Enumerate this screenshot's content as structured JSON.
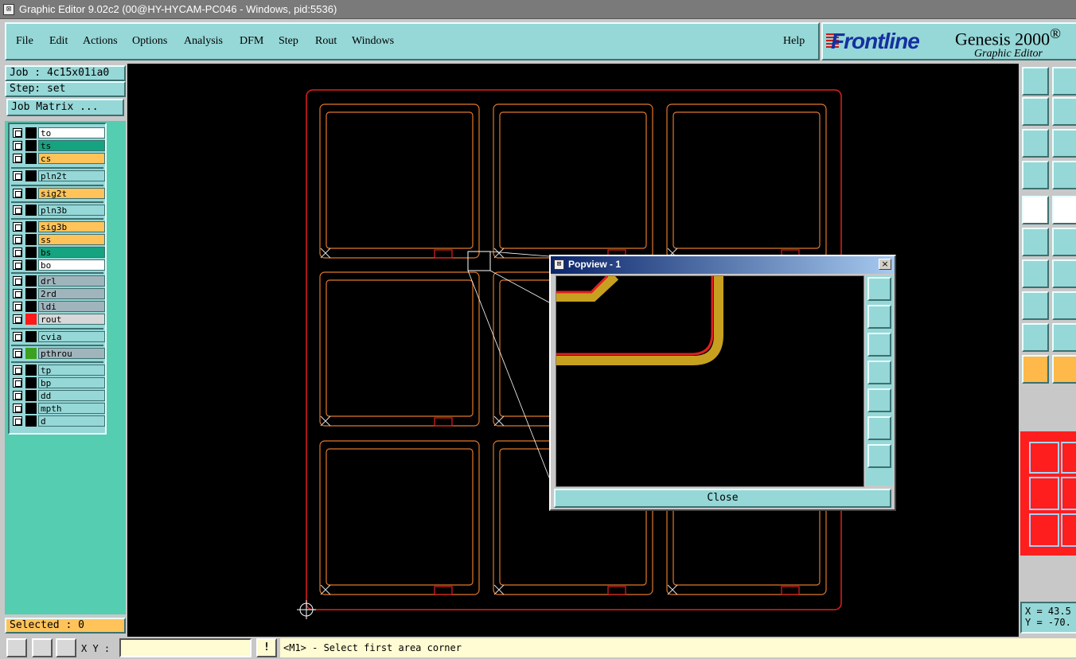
{
  "window": {
    "title": "Graphic Editor 9.02c2 (00@HY-HYCAM-PC046 - Windows, pid:5536)"
  },
  "menu": {
    "items": [
      "File",
      "Edit",
      "Actions",
      "Options",
      "Analysis",
      "DFM",
      "Step",
      "Rout",
      "Windows"
    ],
    "help": "Help"
  },
  "logo": {
    "brand": "Frontline",
    "product": "Genesis 2000",
    "product_suffix": "®",
    "subtitle": "Graphic Editor"
  },
  "job": {
    "label": "Job : 4c15x01ia0",
    "step": "Step: set",
    "matrix_button": "Job Matrix ..."
  },
  "layers": [
    {
      "name": "to",
      "color": "#ffffff",
      "swatch": "#000000"
    },
    {
      "name": "ts",
      "color": "#16a37f",
      "swatch": "#000000"
    },
    {
      "name": "cs",
      "color": "#ffc35a",
      "swatch": "#000000"
    },
    {
      "name": "pln2t",
      "color": "#96d7d7",
      "swatch": "#000000"
    },
    {
      "name": "sig2t",
      "color": "#ffc35a",
      "swatch": "#000000"
    },
    {
      "name": "pln3b",
      "color": "#96d7d7",
      "swatch": "#000000"
    },
    {
      "name": "sig3b",
      "color": "#ffc35a",
      "swatch": "#000000"
    },
    {
      "name": "ss",
      "color": "#ffc35a",
      "swatch": "#000000"
    },
    {
      "name": "bs",
      "color": "#16a37f",
      "swatch": "#000000"
    },
    {
      "name": "bo",
      "color": "#ffffff",
      "swatch": "#000000"
    },
    {
      "name": "drl",
      "color": "#a0b4bc",
      "swatch": "#000000"
    },
    {
      "name": "2rd",
      "color": "#a0b4bc",
      "swatch": "#000000"
    },
    {
      "name": "ldi",
      "color": "#a0b4bc",
      "swatch": "#000000"
    },
    {
      "name": "rout",
      "color": "#d8d8d8",
      "swatch": "#ff1a1a"
    },
    {
      "name": "cvia",
      "color": "#96d7d7",
      "swatch": "#000000"
    },
    {
      "name": "pthrou",
      "color": "#a0b4bc",
      "swatch": "#3ca020"
    },
    {
      "name": "tp",
      "color": "#96d7d7",
      "swatch": "#000000"
    },
    {
      "name": "bp",
      "color": "#96d7d7",
      "swatch": "#000000"
    },
    {
      "name": "dd",
      "color": "#96d7d7",
      "swatch": "#000000"
    },
    {
      "name": "mpth",
      "color": "#96d7d7",
      "swatch": "#000000"
    },
    {
      "name": "d",
      "color": "#96d7d7",
      "swatch": "#000000"
    }
  ],
  "selected": "Selected : 0",
  "popview": {
    "title": "Popview - 1",
    "close_x": "×",
    "close_button": "Close"
  },
  "coords": {
    "x": "X = 43.5",
    "y": "Y = -70."
  },
  "status": {
    "xy_label": "X Y :",
    "xy_value": "",
    "bang": "!",
    "prompt": "<M1> - Select first area corner"
  },
  "colors": {
    "panel": "#96d7d7",
    "layer_bg": "#55cdb0",
    "board_outline": "#e02020",
    "rout_path": "#e0782a",
    "status_bg": "#fffbd2"
  }
}
